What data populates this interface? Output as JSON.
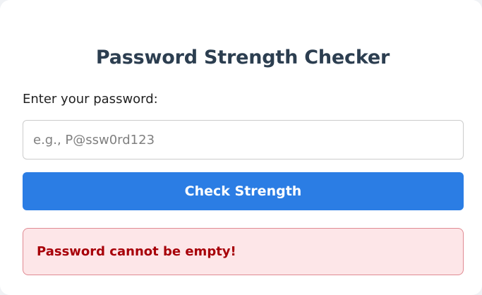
{
  "page": {
    "title": "Password Strength Checker"
  },
  "form": {
    "label": "Enter your password:",
    "password_value": "",
    "password_placeholder": "e.g., P@ssw0rd123",
    "check_button_label": "Check Strength"
  },
  "error": {
    "message": "Password cannot be empty!"
  },
  "colors": {
    "title": "#2c3e50",
    "button_background": "#2b7de4",
    "error_background": "#fde6e8",
    "error_border": "#e08a92",
    "error_text": "#a70008"
  }
}
